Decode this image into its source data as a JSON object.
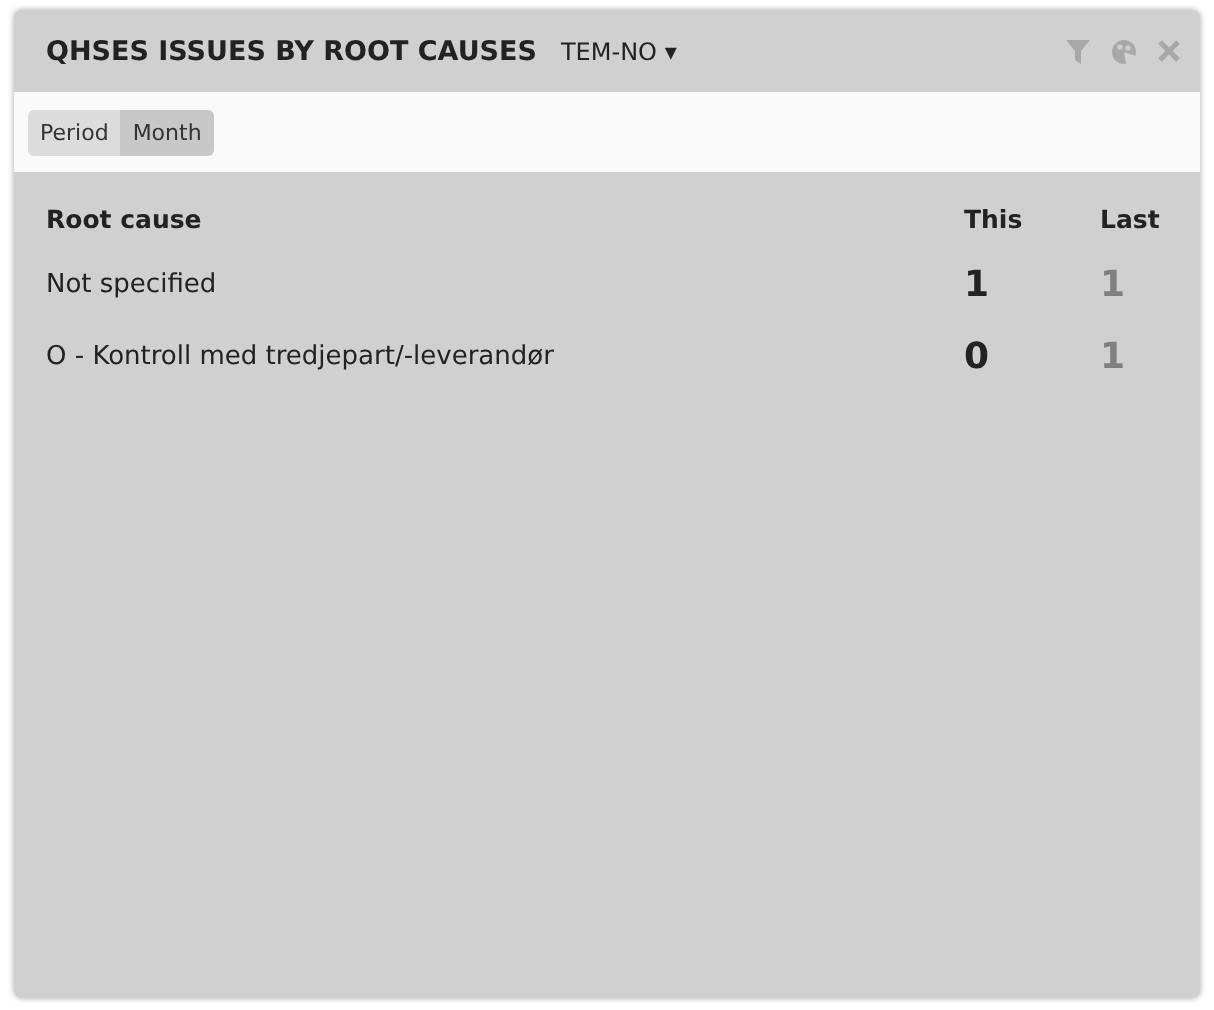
{
  "widget": {
    "title": "QHSES ISSUES BY ROOT CAUSES",
    "unit": "TEM-NO",
    "dropdown_icon": "▾"
  },
  "filters": [
    {
      "label": "Period"
    },
    {
      "label": "Month"
    }
  ],
  "table": {
    "columns": [
      "Root cause",
      "This",
      "Last"
    ],
    "rows": [
      {
        "cause": "Not specified",
        "this": "1",
        "last": "1"
      },
      {
        "cause": "O - Kontroll med tredjepart/-leverandør",
        "this": "0",
        "last": "1"
      }
    ]
  }
}
